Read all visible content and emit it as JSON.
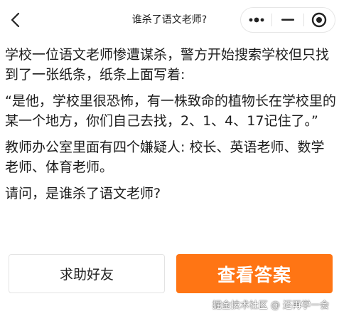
{
  "header": {
    "title": "谁杀了语文老师?",
    "back_icon": "chevron-left-icon",
    "capsule_icons": [
      "more-dots-icon",
      "minimize-icon",
      "close-circle-icon"
    ]
  },
  "content": {
    "paragraphs": [
      "学校一位语文老师惨遭谋杀，警方开始搜索学校但只找到了一张纸条，纸条上面写着:",
      "“是他，学校里很恐怖，有一株致命的植物长在学校里的某一个地方，你们自己去找，2、1、4、17记住了。”",
      "教师办公室里面有四个嫌疑人: 校长、英语老师、数学老师、体育老师。",
      "请问，是谁杀了语文老师?"
    ]
  },
  "actions": {
    "help_label": "求助好友",
    "answer_label": "查看答案",
    "answer_color": "#ff7514"
  },
  "watermark": "掘金技术社区 @ 还再学一会"
}
